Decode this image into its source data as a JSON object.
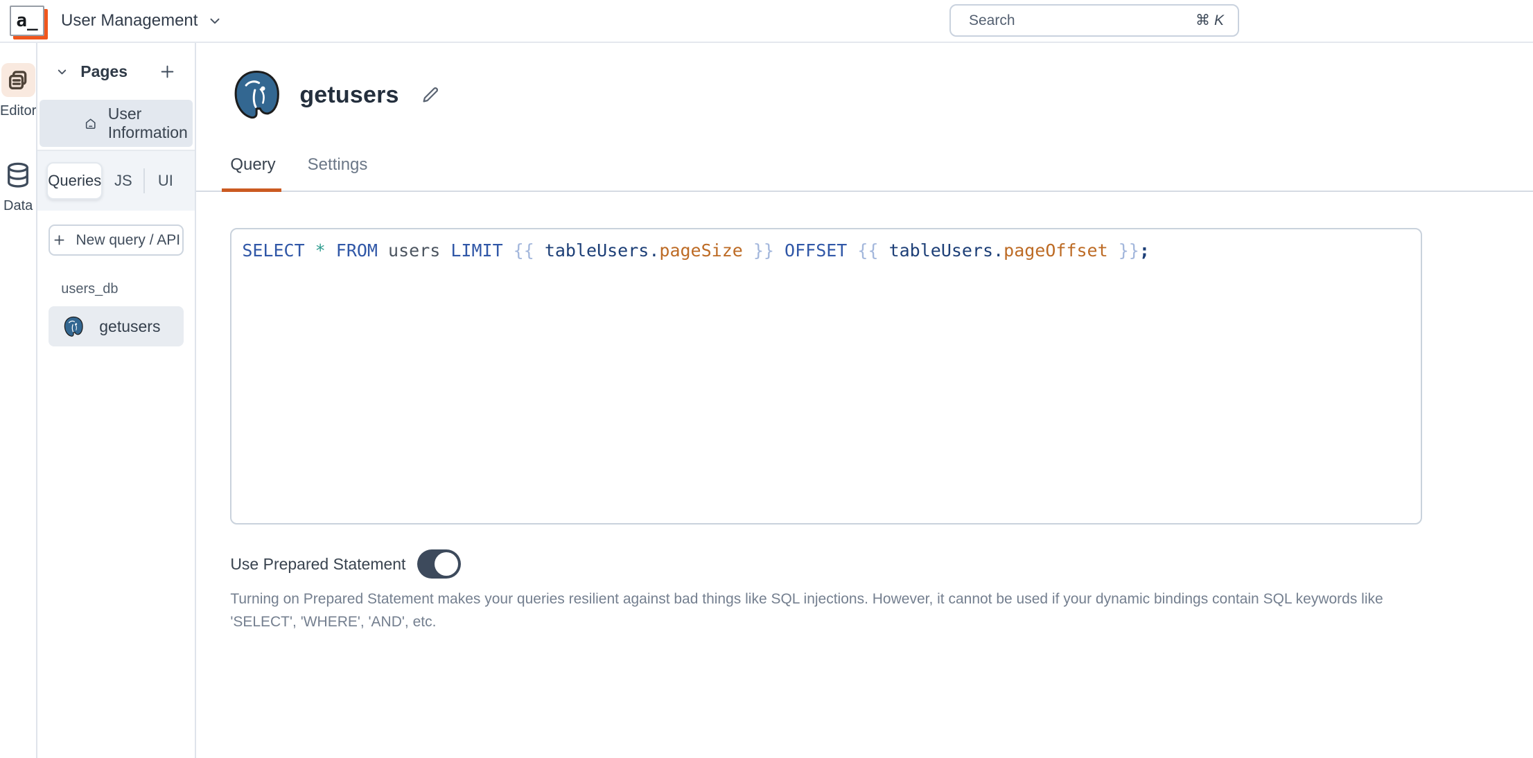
{
  "topbar": {
    "app_title": "User Management",
    "search_placeholder": "Search",
    "search_shortcut_mod": "⌘",
    "search_shortcut_key": "K",
    "logo_text": "a_"
  },
  "rail": {
    "items": [
      {
        "label": "Editor",
        "icon": "pages-icon",
        "active": true
      },
      {
        "label": "Data",
        "icon": "database-icon",
        "active": false
      }
    ]
  },
  "sidebar": {
    "pages_header": {
      "title": "Pages",
      "collapse_icon": "chevron-down-icon",
      "add_icon": "plus-icon"
    },
    "pages": [
      {
        "label": "User Information",
        "icon": "home-icon",
        "selected": true
      }
    ],
    "tabs": [
      {
        "label": "Queries",
        "active": true
      },
      {
        "label": "JS",
        "active": false
      },
      {
        "label": "UI",
        "active": false
      }
    ],
    "new_query_label": "New query / API",
    "datasource_group": "users_db",
    "queries": [
      {
        "label": "getusers",
        "icon": "postgresql-icon",
        "selected": true
      }
    ]
  },
  "main": {
    "query_title": "getusers",
    "title_icon": "postgresql-icon",
    "edit_icon": "pencil-icon",
    "tabs": [
      {
        "label": "Query",
        "active": true
      },
      {
        "label": "Settings",
        "active": false
      }
    ],
    "sql": {
      "text": "SELECT * FROM users LIMIT {{ tableUsers.pageSize }} OFFSET {{ tableUsers.pageOffset }};",
      "tokens": [
        {
          "t": "kw",
          "v": "SELECT "
        },
        {
          "t": "op",
          "v": "* "
        },
        {
          "t": "kw",
          "v": "FROM "
        },
        {
          "t": "id",
          "v": "users "
        },
        {
          "t": "kw",
          "v": "LIMIT "
        },
        {
          "t": "brace",
          "v": "{{ "
        },
        {
          "t": "obj",
          "v": "tableUsers"
        },
        {
          "t": "dot",
          "v": "."
        },
        {
          "t": "prop",
          "v": "pageSize"
        },
        {
          "t": "brace",
          "v": " }} "
        },
        {
          "t": "kw",
          "v": "OFFSET "
        },
        {
          "t": "brace",
          "v": "{{ "
        },
        {
          "t": "obj",
          "v": "tableUsers"
        },
        {
          "t": "dot",
          "v": "."
        },
        {
          "t": "prop",
          "v": "pageOffset"
        },
        {
          "t": "brace",
          "v": " }}"
        },
        {
          "t": "semi",
          "v": ";"
        }
      ]
    },
    "prepared_statement": {
      "label": "Use Prepared Statement",
      "enabled": true,
      "helper_line1": "Turning on Prepared Statement makes your queries resilient against bad things like SQL injections. However, it cannot be used if your dynamic bindings contain SQL keywords like",
      "helper_line2": "'SELECT', 'WHERE', 'AND', etc."
    }
  },
  "theme": {
    "accent_orange": "#CB5A21",
    "logo_shadow_orange": "#F0561D",
    "rail_active_bg": "#F9E9DF",
    "selected_page_bg": "#E3E8EF",
    "query_row_bg": "#E8ECF1",
    "toggle_on_bg": "#3D4A5C",
    "postgres_blue": "#336791",
    "code_colors": {
      "keyword": "#3057A7",
      "operator": "#2E9C8F",
      "identifier": "#4C5560",
      "brace": "#A3B7DC",
      "object": "#1D3F77",
      "property": "#BD6B25",
      "punctuation": "#1D3F77"
    }
  }
}
